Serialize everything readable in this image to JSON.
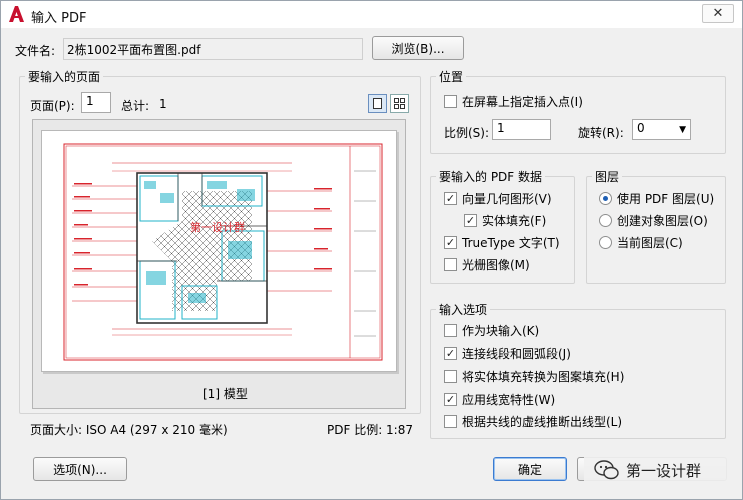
{
  "window": {
    "title": "输入 PDF",
    "close_glyph": "✕"
  },
  "file": {
    "label": "文件名:",
    "value": "2栋1002平面布置图.pdf",
    "browse_label": "浏览(B)..."
  },
  "pages": {
    "group_title": "要输入的页面",
    "page_label": "页面(P):",
    "page_value": "1",
    "total_label": "总计:",
    "total_value": "1",
    "preview_caption": "[1] 模型",
    "watermark_text": "第一设计群",
    "page_size": "页面大小: ISO A4 (297 x 210 毫米)",
    "pdf_scale": "PDF 比例: 1:87"
  },
  "position": {
    "group_title": "位置",
    "onscreen_label": "在屏幕上指定插入点(I)",
    "onscreen_checked": false,
    "scale_label": "比例(S):",
    "scale_value": "1",
    "rotation_label": "旋转(R):",
    "rotation_value": "0"
  },
  "pdf_data": {
    "group_title": "要输入的 PDF 数据",
    "items": [
      {
        "label": "向量几何图形(V)",
        "checked": true
      },
      {
        "label": "实体填充(F)",
        "checked": true
      },
      {
        "label": "TrueType 文字(T)",
        "checked": true
      },
      {
        "label": "光栅图像(M)",
        "checked": false
      }
    ]
  },
  "layers": {
    "group_title": "图层",
    "options": [
      {
        "label": "使用 PDF 图层(U)",
        "selected": true
      },
      {
        "label": "创建对象图层(O)",
        "selected": false
      },
      {
        "label": "当前图层(C)",
        "selected": false
      }
    ]
  },
  "import_options": {
    "group_title": "输入选项",
    "items": [
      {
        "label": "作为块输入(K)",
        "checked": false
      },
      {
        "label": "连接线段和圆弧段(J)",
        "checked": true
      },
      {
        "label": "将实体填充转换为图案填充(H)",
        "checked": false
      },
      {
        "label": "应用线宽特性(W)",
        "checked": true
      },
      {
        "label": "根据共线的虚线推断出线型(L)",
        "checked": false
      }
    ]
  },
  "buttons": {
    "options": "选项(N)...",
    "ok": "确定"
  },
  "overlay": {
    "wechat_text": "第一设计群"
  },
  "colors": {
    "drawing_red": "#d8242c",
    "drawing_cyan": "#22b3c9",
    "accent_blue": "#3b7bd1"
  }
}
